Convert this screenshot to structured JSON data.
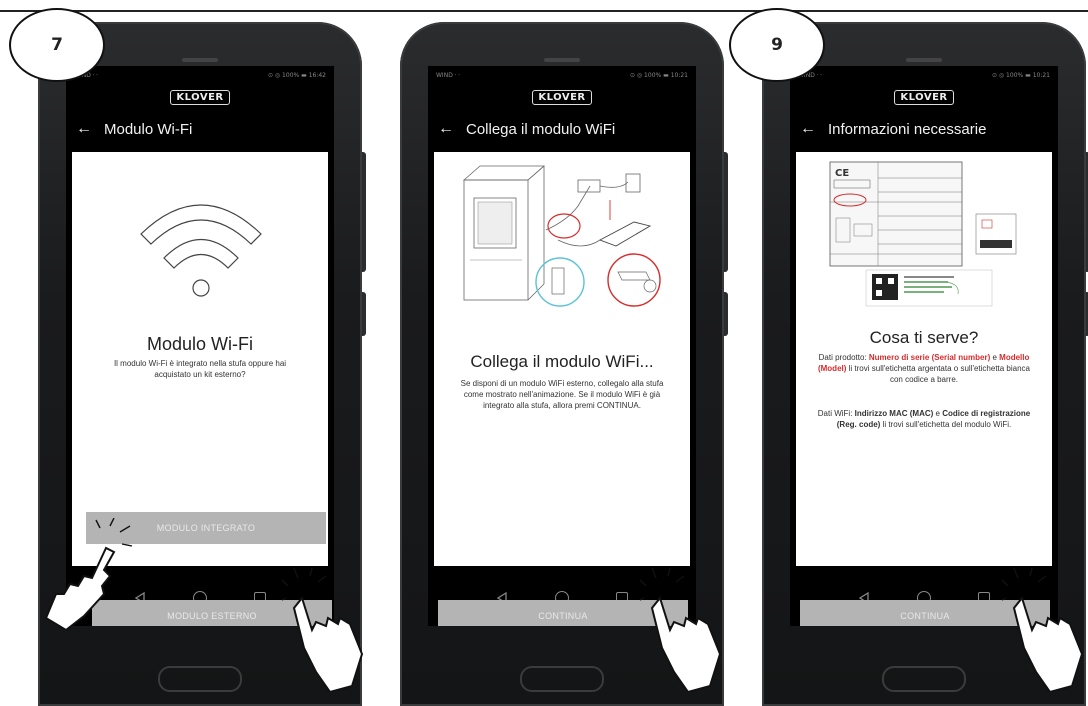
{
  "steps": {
    "first": "7",
    "third": "9"
  },
  "phones": [
    {
      "status_left": "WIND ⸱ ⸱",
      "status_right": "⊙ ◎ 100% ▬ 16:42",
      "logo": "KLOVER",
      "back_icon": "back-arrow-icon",
      "title": "Modulo Wi-Fi",
      "heading": "Modulo Wi-Fi",
      "body": "Il modulo Wi-Fi è integrato nella stufa oppure hai acquistato un kit esterno?",
      "button_integrated": "MODULO INTEGRATO",
      "button_external": "MODULO ESTERNO"
    },
    {
      "status_left": "WIND ⸱ ⸱",
      "status_right": "⊙ ◎ 100% ▬ 10:21",
      "logo": "KLOVER",
      "title": "Collega il modulo WiFi",
      "heading": "Collega il modulo WiFi...",
      "body": "Se disponi di un modulo WiFi esterno, collegalo alla stufa come mostrato nell'animazione. Se il modulo WiFi è già integrato alla stufa, allora premi CONTINUA.",
      "button_continue": "CONTINUA"
    },
    {
      "status_left": "WIND ⸱ ⸱",
      "status_right": "⊙ ◎ 100% ▬ 10:21",
      "logo": "KLOVER",
      "title": "Informazioni necessarie",
      "heading": "Cosa ti serve?",
      "product_prefix": "Dati prodotto: ",
      "product_serial": "Numero di serie (Serial number)",
      "product_and": " e ",
      "product_model": "Modello (Model)",
      "product_suffix": " li trovi sull'etichetta argentata o sull'etichetta bianca con codice a barre.",
      "wifi_prefix": "Dati WiFi: ",
      "wifi_mac": "Indirizzo MAC (MAC)",
      "wifi_and": " e ",
      "wifi_code": "Codice di registrazione (Reg. code)",
      "wifi_suffix": " li trovi sull'etichetta del modulo WiFi.",
      "button_continue": "CONTINUA"
    }
  ],
  "nav": {
    "back_icon": "nav-back-icon",
    "home_icon": "nav-home-icon",
    "recents_icon": "nav-recents-icon"
  },
  "colors": {
    "accent_red": "#d62c2c",
    "button_grey": "#b4b4b4",
    "appbar_bg": "#000000"
  }
}
